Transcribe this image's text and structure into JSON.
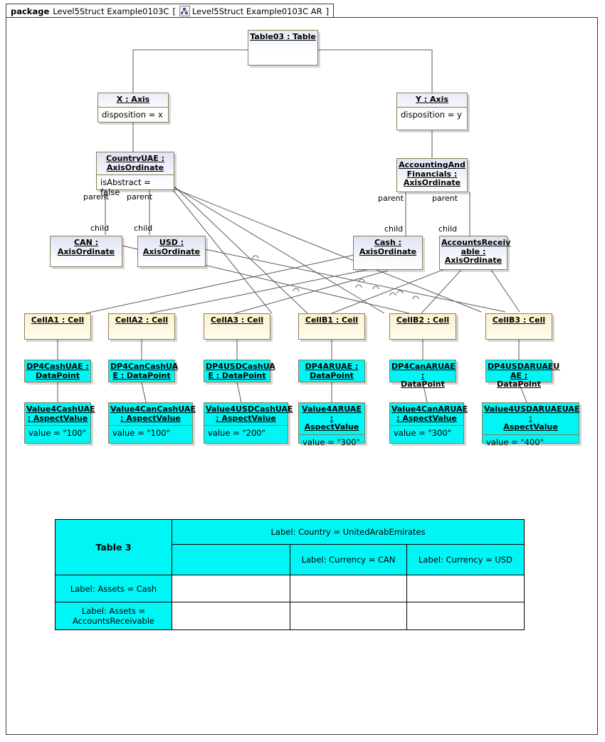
{
  "package": {
    "keyword": "package",
    "name": "Level5Struct Example0103C",
    "bracket_open": "[",
    "icon": "tree-diagram-icon",
    "diagram_name": "Level5Struct Example0103C AR",
    "bracket_close": "]"
  },
  "nodes": {
    "table03": {
      "title": "Table03 : Table"
    },
    "x_axis": {
      "title": "X : Axis",
      "attr": "disposition = x"
    },
    "y_axis": {
      "title": "Y : Axis",
      "attr": "disposition = y"
    },
    "country_uae": {
      "title_l1": "CountryUAE :",
      "title_l2": "AxisOrdinate",
      "attr": "isAbstract = false"
    },
    "accounting": {
      "title_l1": "AccountingAnd",
      "title_l2": "Financials :",
      "title_l3": "AxisOrdinate"
    },
    "can": {
      "title_l1": "CAN :",
      "title_l2": "AxisOrdinate"
    },
    "usd": {
      "title_l1": "USD :",
      "title_l2": "AxisOrdinate"
    },
    "cash": {
      "title_l1": "Cash :",
      "title_l2": "AxisOrdinate"
    },
    "accounts_recv": {
      "title_l1": "AccountsReceiv",
      "title_l2": "able :",
      "title_l3": "AxisOrdinate"
    },
    "cellA1": {
      "title": "CellA1 : Cell"
    },
    "cellA2": {
      "title": "CellA2 : Cell"
    },
    "cellA3": {
      "title": "CellA3 : Cell"
    },
    "cellB1": {
      "title": "CellB1 : Cell"
    },
    "cellB2": {
      "title": "CellB2 : Cell"
    },
    "cellB3": {
      "title": "CellB3 : Cell"
    },
    "dp1": {
      "title_l1": "DP4CashUAE :",
      "title_l2": "DataPoint"
    },
    "dp2": {
      "title_l1": "DP4CanCashUA",
      "title_l2": "E : DataPoint"
    },
    "dp3": {
      "title_l1": "DP4USDCashUA",
      "title_l2": "E : DataPoint"
    },
    "dp4": {
      "title_l1": "DP4ARUAE :",
      "title_l2": "DataPoint"
    },
    "dp5": {
      "title_l1": "DP4CanARUAE :",
      "title_l2": "DataPoint"
    },
    "dp6": {
      "title_l1": "DP4USDARUAEU",
      "title_l2": "AE : DataPoint"
    },
    "av1": {
      "title_l1": "Value4CashUAE",
      "title_l2": ": AspectValue",
      "attr": "value = \"100\""
    },
    "av2": {
      "title_l1": "Value4CanCashUAE",
      "title_l2": ": AspectValue",
      "attr": "value = \"100\""
    },
    "av3": {
      "title_l1": "Value4USDCashUAE",
      "title_l2": ": AspectValue",
      "attr": "value = \"200\""
    },
    "av4": {
      "title_l1": "Value4ARUAE :",
      "title_l2": "AspectValue",
      "attr": "value = \"300\""
    },
    "av5": {
      "title_l1": "Value4CanARUAE",
      "title_l2": ": AspectValue",
      "attr": "value = \"300\""
    },
    "av6": {
      "title_l1": "Value4USDARUAEUAE :",
      "title_l2": "AspectValue",
      "attr": "value = \"400\""
    }
  },
  "edge_labels": {
    "p1": "parent",
    "c1": "child",
    "p2": "parent",
    "c2": "child",
    "p3": "parent",
    "c3": "child",
    "p4": "parent",
    "c4": "child"
  },
  "table": {
    "corner": "Table 3",
    "country_header": "Label: Country = UnitedArabEmirates",
    "currency_can": "Label: Currency = CAN",
    "currency_usd": "Label: Currency = USD",
    "row_cash": "Label: Assets = Cash",
    "row_ar_l1": "Label: Assets =",
    "row_ar_l2": "AccountsReceivable"
  },
  "colors": {
    "cyan": "#00F5F5",
    "yellow": "#FDF2CD",
    "blue": "#E8ECF6",
    "border": "#8A7F55",
    "line": "#5A5A5A"
  }
}
